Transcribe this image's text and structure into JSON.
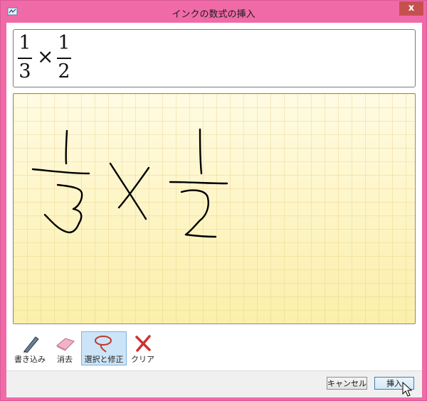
{
  "window": {
    "title": "インクの数式の挿入",
    "close_glyph": "x"
  },
  "preview": {
    "numerator_1": "1",
    "denominator_1": "3",
    "operator": "×",
    "numerator_2": "1",
    "denominator_2": "2"
  },
  "ink_area": {
    "icon": "handwritten-ink-strokes",
    "ink_color": "#000000"
  },
  "toolbar": {
    "items": [
      {
        "label": "書き込み",
        "icon": "pen-icon",
        "active": false
      },
      {
        "label": "消去",
        "icon": "eraser-icon",
        "active": false
      },
      {
        "label": "選択と修正",
        "icon": "lasso-icon",
        "active": true
      },
      {
        "label": "クリア",
        "icon": "clear-x-icon",
        "active": false
      }
    ]
  },
  "buttons": {
    "cancel_label": "キャンセル",
    "insert_label": "挿入"
  },
  "colors": {
    "window_frame": "#f06aa8",
    "close_button": "#c7504f",
    "active_tool": "#cce4f7"
  }
}
